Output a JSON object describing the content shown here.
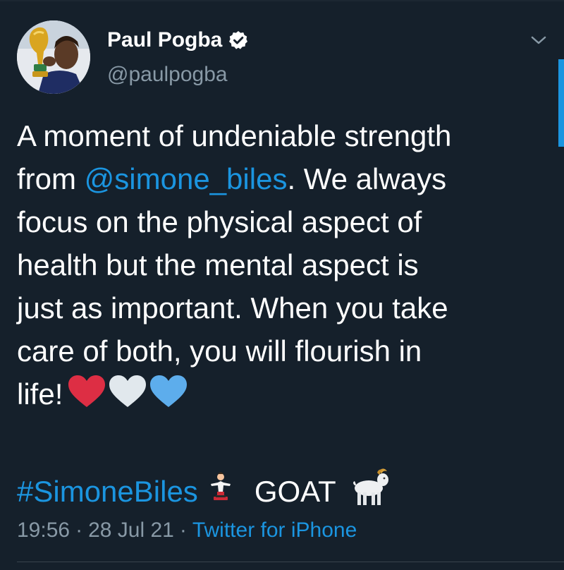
{
  "author": {
    "display_name": "Paul Pogba",
    "handle": "@paulpogba",
    "verified": true,
    "avatar_icon": "profile-photo-with-trophy"
  },
  "tweet": {
    "lines": [
      {
        "text": "A moment of undeniable strength"
      },
      {
        "prefix": "from ",
        "mention": "@simone_biles",
        "suffix": ". We always"
      },
      {
        "text": "focus on the physical aspect of"
      },
      {
        "text": "health but the mental aspect is"
      },
      {
        "text": "just as important. When you take"
      },
      {
        "text": "care of both, you will flourish in"
      },
      {
        "text": "life!"
      }
    ],
    "emoji_hearts": [
      "red-heart",
      "white-heart",
      "blue-heart"
    ],
    "hashtag": "#SimoneBiles",
    "goat_text": "GOAT",
    "emoji_extras": [
      "gymnast-emoji",
      "goat-emoji"
    ]
  },
  "meta": {
    "time": "19:56",
    "separator": "·",
    "date": "28 Jul 21",
    "source": "Twitter for iPhone"
  },
  "colors": {
    "background": "#15202b",
    "text": "#ffffff",
    "secondary": "#8899a6",
    "accent": "#1b95e0",
    "heart_red": "#dd2e44",
    "heart_white": "#e1e8ed",
    "heart_blue": "#5dadec"
  },
  "icons": {
    "verified": "verified-badge-icon",
    "menu": "chevron-down-icon"
  }
}
